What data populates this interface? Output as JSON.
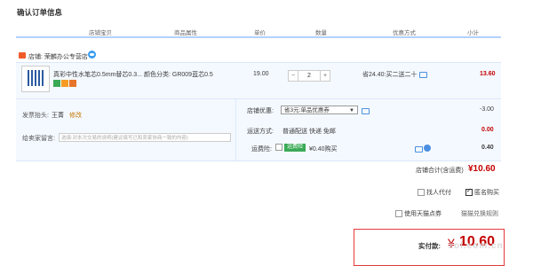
{
  "page_title": "确认订单信息",
  "headers": [
    "店铺宝贝",
    "商品属性",
    "单价",
    "数量",
    "优惠方式",
    "小计"
  ],
  "shop": {
    "label": "店铺: 荣麟办公专营店"
  },
  "product": {
    "name": "真彩中性水笔芯0.5mm替芯0.3...",
    "attr": "颜色分类: GR009蓝芯0.5",
    "unit_price": "19.00",
    "quantity": "2",
    "discount": "省24.40:买二送二十",
    "subtotal": "13.60"
  },
  "invoice": {
    "label": "发票抬头:",
    "name": "王菁",
    "edit": "修改"
  },
  "message": {
    "label": "给卖家留言:",
    "placeholder": "选填:对本次交易的说明(建议填写已和卖家协商一致的内容)"
  },
  "shop_discount": {
    "label": "店铺优惠:",
    "selected": "省3元:单品优惠券",
    "amount": "-3.00"
  },
  "shipping": {
    "label": "运送方式:",
    "value": "普通配送 快递 免邮",
    "amount": "0.00"
  },
  "insurance": {
    "label": "运费险:",
    "tag": "运费险",
    "value": "¥0.40购买",
    "amount": "0.40"
  },
  "shop_total": {
    "label": "店铺合计(含运费)",
    "amount": "¥10.60"
  },
  "options": {
    "proxy": "找人代付",
    "anonymous": "匿名购买",
    "tmall_points": "使用天猫点券",
    "points_rule": "猫猫兑换规则"
  },
  "payment": {
    "label": "实付款:",
    "currency": "¥",
    "amount": "10.60"
  },
  "watermark": "zol.com.cn",
  "colors": {
    "accent_red": "#c40000",
    "header_line": "#b2d1ff",
    "row_bg": "#f4f9ff"
  }
}
